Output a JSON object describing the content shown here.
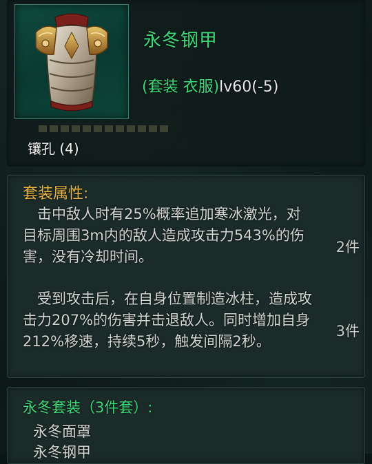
{
  "item": {
    "name": "永冬钢甲",
    "type_prefix": "(套装 衣服)",
    "type_level": "lv60(-5)",
    "socket": "镶孔 (4)",
    "icon": "armor-chestplate-icon"
  },
  "set_bonus": {
    "title": "套装属性:",
    "effects": [
      {
        "text": "击中敌人时有25%概率追加寒冰激光，对目标周围3m内的敌人造成攻击力543%的伤害，没有冷却时间。",
        "count": "2件"
      },
      {
        "text": "受到攻击后，在自身位置制造冰柱，造成攻击力207%的伤害并击退敌人。同时增加自身212%移速，持续5秒，触发间隔2秒。",
        "count": "3件"
      }
    ]
  },
  "set_list": {
    "title": "永冬套装（3件套）:",
    "items": [
      "永冬面罩",
      "永冬钢甲"
    ]
  },
  "colors": {
    "item_name": "#3fd97a",
    "set_title": "#e8b640",
    "body_text": "#d2d6d3",
    "background": "#0a1515"
  }
}
